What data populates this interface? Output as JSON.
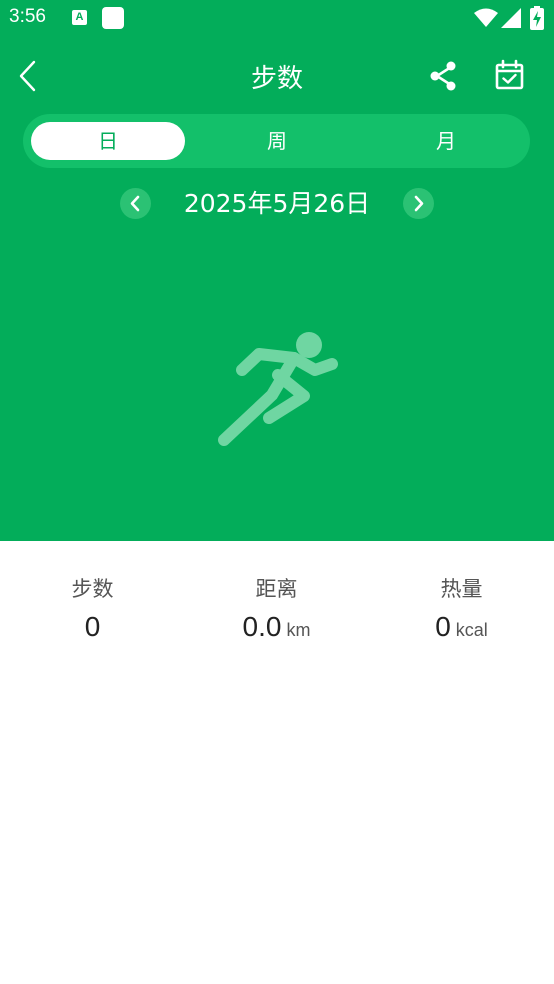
{
  "status_bar": {
    "time": "3:56",
    "app_icon_letter": "A",
    "icons": [
      "app-a-icon",
      "app-blank-icon",
      "wifi-icon",
      "signal-icon",
      "battery-charging-icon"
    ]
  },
  "header": {
    "title": "步数",
    "back_icon": "back-arrow-icon",
    "share_icon": "share-icon",
    "calendar_icon": "calendar-check-icon"
  },
  "tabs": [
    {
      "label": "日",
      "active": true
    },
    {
      "label": "周",
      "active": false
    },
    {
      "label": "月",
      "active": false
    }
  ],
  "date_nav": {
    "date": "2025年5月26日",
    "prev_icon": "chevron-left-icon",
    "next_icon": "chevron-right-icon"
  },
  "illustration": {
    "icon": "runner-icon"
  },
  "stats": [
    {
      "label": "步数",
      "value": "0",
      "unit": ""
    },
    {
      "label": "距离",
      "value": "0.0",
      "unit": "km"
    },
    {
      "label": "热量",
      "value": "0",
      "unit": "kcal"
    }
  ],
  "colors": {
    "primary_green": "#03ad5a",
    "tab_bar_green": "#13c06a",
    "date_button_green": "#2bc274",
    "runner_green": "#6fd6a2"
  }
}
